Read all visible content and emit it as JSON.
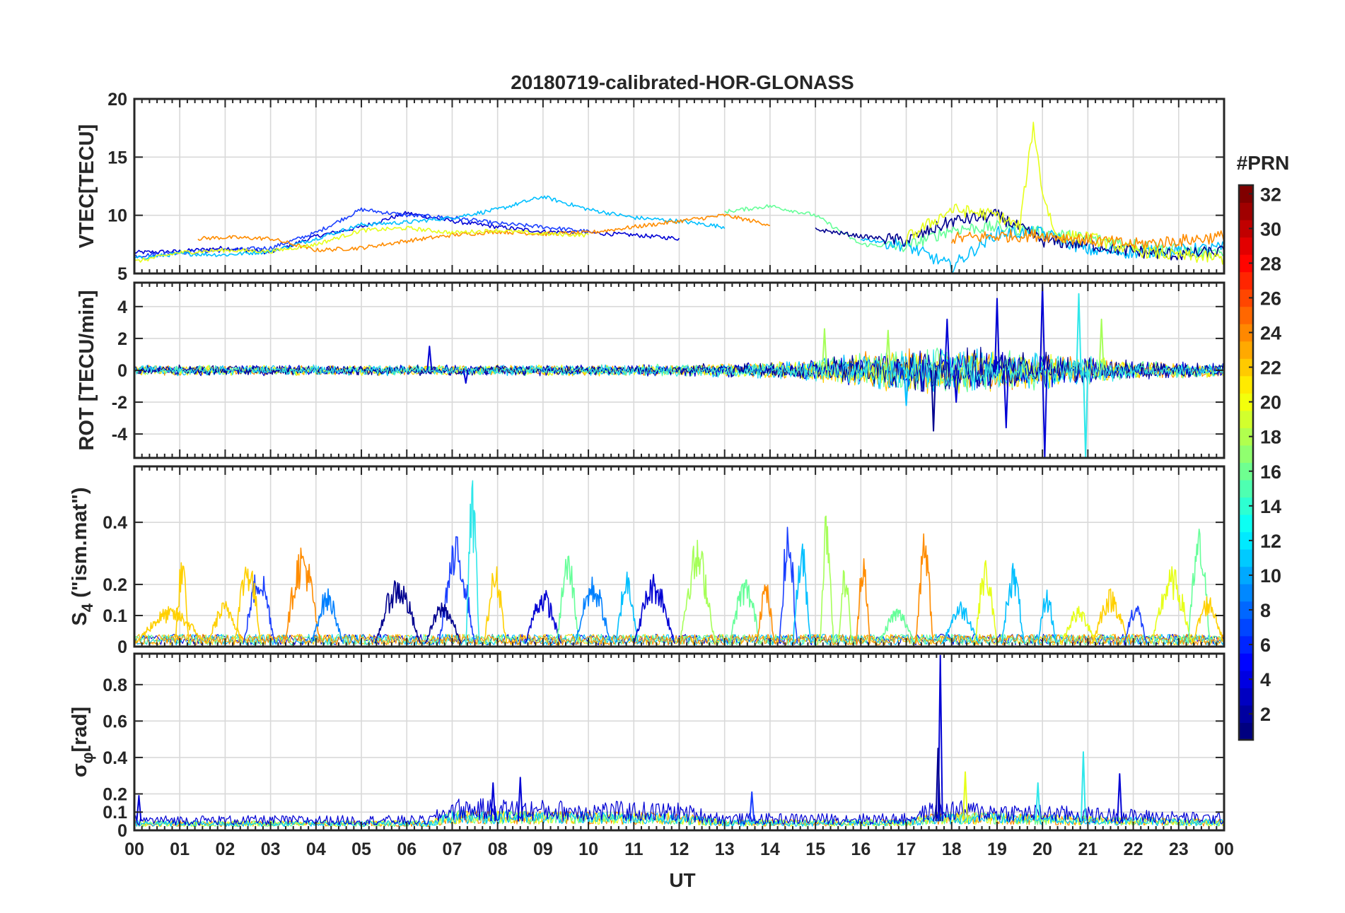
{
  "figure_title": "20180719-calibrated-HOR-GLONASS",
  "x_axis_label": "UT",
  "colorbar_label": "#PRN",
  "series_colors": [
    "#00008f",
    "#0000d4",
    "#1a3fff",
    "#0080ff",
    "#00bfff",
    "#2fe7ea",
    "#66ff99",
    "#a6ff59",
    "#e6ff19",
    "#ffd000",
    "#ff8c00",
    "#ff4500"
  ],
  "chart_data": [
    {
      "type": "line",
      "id": "vtec",
      "ylabel": "VTEC[TECU]",
      "ylim": [
        5,
        20
      ],
      "yticks": [
        5,
        10,
        15,
        20
      ],
      "xlim": [
        0,
        24
      ],
      "xtick_labels": [
        "00",
        "01",
        "02",
        "03",
        "04",
        "05",
        "06",
        "07",
        "08",
        "09",
        "10",
        "11",
        "12",
        "13",
        "14",
        "15",
        "16",
        "17",
        "18",
        "19",
        "20",
        "21",
        "22",
        "23",
        "00"
      ],
      "grid": true,
      "series_note": "multiple PRN traces, approximate values read from plot",
      "series": [
        {
          "color_index": 1,
          "x": [
            0,
            1,
            2,
            3,
            4,
            5,
            6,
            7,
            8,
            9,
            10,
            11,
            12
          ],
          "y": [
            6.8,
            6.9,
            7.2,
            6.8,
            8.2,
            9.0,
            10.2,
            9.5,
            9.0,
            8.6,
            8.5,
            8.3,
            8.0
          ]
        },
        {
          "color_index": 2,
          "x": [
            0,
            1,
            2,
            3,
            4,
            5,
            6,
            7,
            8,
            9,
            10
          ],
          "y": [
            6.5,
            6.8,
            7.0,
            7.2,
            8.5,
            10.5,
            10.0,
            9.8,
            9.3,
            9.0,
            8.6
          ]
        },
        {
          "color_index": 4,
          "x": [
            0,
            1,
            2,
            3,
            4,
            5,
            6,
            7,
            8,
            9,
            10,
            11,
            12,
            13
          ],
          "y": [
            6.3,
            6.7,
            6.6,
            6.9,
            8.0,
            9.2,
            9.4,
            9.8,
            10.5,
            11.6,
            10.5,
            9.8,
            9.5,
            9.0
          ]
        },
        {
          "color_index": 10,
          "x": [
            1.4,
            2,
            3,
            4,
            5,
            6,
            7,
            8,
            9,
            10,
            11,
            12,
            13,
            14
          ],
          "y": [
            8.0,
            8.1,
            8.0,
            7.0,
            7.2,
            7.8,
            8.3,
            8.6,
            8.4,
            8.5,
            9.0,
            9.5,
            10.0,
            9.2
          ]
        },
        {
          "color_index": 8,
          "x": [
            0,
            1,
            2,
            3,
            4,
            5,
            6,
            7,
            8,
            9,
            10
          ],
          "y": [
            6.0,
            6.8,
            7.0,
            6.9,
            7.5,
            8.7,
            8.9,
            8.5,
            8.7,
            8.4,
            8.3
          ]
        },
        {
          "color_index": 6,
          "x": [
            13,
            14,
            15,
            16,
            17,
            18,
            19,
            20,
            21,
            22,
            23,
            24
          ],
          "y": [
            10.3,
            10.8,
            10.0,
            7.5,
            7.3,
            8.8,
            9.0,
            8.5,
            8.0,
            7.5,
            7.0,
            6.6
          ]
        },
        {
          "color_index": 4,
          "x": [
            16,
            17,
            18,
            19,
            20,
            21,
            22,
            23,
            24
          ],
          "y": [
            8.0,
            7.4,
            5.6,
            8.5,
            8.5,
            7.0,
            6.8,
            7.0,
            7.2
          ]
        },
        {
          "color_index": 0,
          "x": [
            15,
            16,
            17,
            18,
            19,
            20,
            21,
            22,
            23,
            24
          ],
          "y": [
            8.8,
            8.2,
            7.8,
            9.5,
            10.0,
            7.8,
            7.5,
            6.9,
            6.6,
            6.9
          ]
        },
        {
          "color_index": 8,
          "x": [
            17,
            18,
            19,
            19.5,
            19.8,
            20,
            20.3,
            21,
            22,
            23,
            24
          ],
          "y": [
            8.0,
            10.5,
            10.0,
            9.0,
            17.8,
            12.0,
            8.2,
            8.1,
            7.0,
            6.5,
            6.3
          ]
        },
        {
          "color_index": 10,
          "x": [
            18,
            19,
            20,
            21,
            22,
            23,
            24
          ],
          "y": [
            8.0,
            8.2,
            8.3,
            7.9,
            7.5,
            7.8,
            8.2
          ]
        }
      ]
    },
    {
      "type": "line",
      "id": "rot",
      "ylabel": "ROT [TECU/min]",
      "ylim": [
        -5.5,
        5.5
      ],
      "yticks": [
        -4,
        -2,
        0,
        2,
        4
      ],
      "xlim": [
        0,
        24
      ],
      "grid": true,
      "noise_envelope_note": "approximate envelope of rate-of-TEC fluctuations",
      "spikes": [
        {
          "x": 6.5,
          "y": 1.5,
          "color_index": 1
        },
        {
          "x": 7.3,
          "y": -0.8,
          "color_index": 1
        },
        {
          "x": 15.2,
          "y": 2.6,
          "color_index": 7
        },
        {
          "x": 16.6,
          "y": 2.5,
          "color_index": 7
        },
        {
          "x": 17.0,
          "y": -2.2,
          "color_index": 4
        },
        {
          "x": 17.6,
          "y": -3.8,
          "color_index": 0
        },
        {
          "x": 17.9,
          "y": 3.2,
          "color_index": 1
        },
        {
          "x": 18.1,
          "y": -2.0,
          "color_index": 1
        },
        {
          "x": 19.0,
          "y": 4.5,
          "color_index": 1
        },
        {
          "x": 19.2,
          "y": -3.6,
          "color_index": 1
        },
        {
          "x": 20.0,
          "y": 5.4,
          "color_index": 1
        },
        {
          "x": 20.05,
          "y": -5.5,
          "color_index": 1
        },
        {
          "x": 20.8,
          "y": 4.8,
          "color_index": 5
        },
        {
          "x": 20.95,
          "y": -5.5,
          "color_index": 5
        },
        {
          "x": 21.3,
          "y": 3.2,
          "color_index": 7
        }
      ],
      "envelope": {
        "x": [
          0,
          5,
          12,
          14.5,
          16,
          17,
          18,
          19,
          20,
          21,
          22,
          24
        ],
        "amp": [
          0.35,
          0.35,
          0.4,
          0.6,
          1.2,
          1.5,
          1.6,
          1.4,
          1.3,
          1.0,
          0.6,
          0.5
        ]
      }
    },
    {
      "type": "line",
      "id": "s4",
      "ylabel": "S4 (\"ism.mat\")",
      "ylabel_main": "S",
      "ylabel_sub": "4",
      "ylabel_rest": " (\"ism.mat\")",
      "ylim": [
        0,
        0.58
      ],
      "yticks": [
        0,
        0.1,
        0.2,
        0.4
      ],
      "ytick_labels": [
        "0",
        "0.1",
        "0.2",
        "0.4"
      ],
      "xlim": [
        0,
        24
      ],
      "grid": true,
      "bumps": [
        {
          "x0": 0.0,
          "x1": 1.6,
          "peak": 0.12,
          "color_index": 9
        },
        {
          "x0": 0.9,
          "x1": 1.2,
          "peak": 0.29,
          "color_index": 9
        },
        {
          "x0": 1.6,
          "x1": 2.4,
          "peak": 0.14,
          "color_index": 9
        },
        {
          "x0": 2.4,
          "x1": 3.1,
          "peak": 0.26,
          "color_index": 2
        },
        {
          "x0": 2.2,
          "x1": 2.8,
          "peak": 0.3,
          "color_index": 9
        },
        {
          "x0": 3.3,
          "x1": 4.1,
          "peak": 0.33,
          "color_index": 10
        },
        {
          "x0": 3.9,
          "x1": 4.6,
          "peak": 0.18,
          "color_index": 3
        },
        {
          "x0": 5.3,
          "x1": 6.3,
          "peak": 0.22,
          "color_index": 0
        },
        {
          "x0": 6.7,
          "x1": 7.5,
          "peak": 0.35,
          "color_index": 2
        },
        {
          "x0": 6.4,
          "x1": 7.2,
          "peak": 0.14,
          "color_index": 0
        },
        {
          "x0": 7.3,
          "x1": 7.6,
          "peak": 0.54,
          "color_index": 5
        },
        {
          "x0": 7.7,
          "x1": 8.2,
          "peak": 0.26,
          "color_index": 9
        },
        {
          "x0": 8.6,
          "x1": 9.4,
          "peak": 0.18,
          "color_index": 1
        },
        {
          "x0": 9.3,
          "x1": 9.8,
          "peak": 0.31,
          "color_index": 6
        },
        {
          "x0": 9.7,
          "x1": 10.5,
          "peak": 0.22,
          "color_index": 3
        },
        {
          "x0": 10.6,
          "x1": 11.1,
          "peak": 0.25,
          "color_index": 4
        },
        {
          "x0": 11.0,
          "x1": 11.9,
          "peak": 0.23,
          "color_index": 1
        },
        {
          "x0": 12.0,
          "x1": 12.8,
          "peak": 0.34,
          "color_index": 7
        },
        {
          "x0": 13.1,
          "x1": 13.8,
          "peak": 0.22,
          "color_index": 6
        },
        {
          "x0": 13.7,
          "x1": 14.1,
          "peak": 0.21,
          "color_index": 10
        },
        {
          "x0": 14.2,
          "x1": 14.6,
          "peak": 0.4,
          "color_index": 2
        },
        {
          "x0": 14.5,
          "x1": 14.9,
          "peak": 0.34,
          "color_index": 4
        },
        {
          "x0": 15.1,
          "x1": 15.4,
          "peak": 0.47,
          "color_index": 7
        },
        {
          "x0": 15.5,
          "x1": 15.8,
          "peak": 0.26,
          "color_index": 7
        },
        {
          "x0": 15.9,
          "x1": 16.2,
          "peak": 0.33,
          "color_index": 10
        },
        {
          "x0": 16.4,
          "x1": 17.2,
          "peak": 0.12,
          "color_index": 6
        },
        {
          "x0": 17.2,
          "x1": 17.6,
          "peak": 0.36,
          "color_index": 10
        },
        {
          "x0": 17.8,
          "x1": 18.6,
          "peak": 0.14,
          "color_index": 4
        },
        {
          "x0": 18.5,
          "x1": 19.0,
          "peak": 0.28,
          "color_index": 8
        },
        {
          "x0": 19.1,
          "x1": 19.6,
          "peak": 0.27,
          "color_index": 4
        },
        {
          "x0": 19.9,
          "x1": 20.3,
          "peak": 0.18,
          "color_index": 4
        },
        {
          "x0": 20.4,
          "x1": 21.2,
          "peak": 0.12,
          "color_index": 8
        },
        {
          "x0": 21.1,
          "x1": 21.9,
          "peak": 0.18,
          "color_index": 9
        },
        {
          "x0": 21.8,
          "x1": 22.3,
          "peak": 0.14,
          "color_index": 2
        },
        {
          "x0": 22.4,
          "x1": 23.3,
          "peak": 0.25,
          "color_index": 8
        },
        {
          "x0": 23.2,
          "x1": 23.7,
          "peak": 0.38,
          "color_index": 6
        },
        {
          "x0": 23.3,
          "x1": 24.0,
          "peak": 0.16,
          "color_index": 9
        }
      ]
    },
    {
      "type": "line",
      "id": "sigma_phi",
      "ylabel": "σφ[rad]",
      "ylabel_main": "σ",
      "ylabel_sub": "φ",
      "ylabel_rest": "[rad]",
      "ylim": [
        0,
        0.97
      ],
      "yticks": [
        0,
        0.1,
        0.2,
        0.4,
        0.6,
        0.8
      ],
      "ytick_labels": [
        "0",
        "0.1",
        "0.2",
        "0.4",
        "0.6",
        "0.8"
      ],
      "xlim": [
        0,
        24
      ],
      "grid": true,
      "baseline": {
        "x": [
          0,
          6.5,
          7,
          12,
          13,
          17,
          17.5,
          18,
          22,
          24
        ],
        "level": [
          0.06,
          0.06,
          0.14,
          0.12,
          0.07,
          0.07,
          0.12,
          0.13,
          0.09,
          0.07
        ]
      },
      "spikes": [
        {
          "x": 17.75,
          "y": 0.96,
          "color_index": 1
        },
        {
          "x": 17.7,
          "y": 0.45,
          "color_index": 0
        },
        {
          "x": 18.3,
          "y": 0.32,
          "color_index": 8
        },
        {
          "x": 8.5,
          "y": 0.29,
          "color_index": 1
        },
        {
          "x": 7.9,
          "y": 0.26,
          "color_index": 1
        },
        {
          "x": 20.9,
          "y": 0.43,
          "color_index": 5
        },
        {
          "x": 21.7,
          "y": 0.31,
          "color_index": 1
        },
        {
          "x": 19.9,
          "y": 0.26,
          "color_index": 5
        },
        {
          "x": 13.6,
          "y": 0.21,
          "color_index": 2
        },
        {
          "x": 0.1,
          "y": 0.19,
          "color_index": 1
        }
      ]
    }
  ],
  "colorbar": {
    "min": 1,
    "max": 32,
    "tick_values": [
      2,
      4,
      6,
      8,
      10,
      12,
      14,
      16,
      18,
      20,
      22,
      24,
      26,
      28,
      30,
      32
    ],
    "colormap": "jet"
  }
}
